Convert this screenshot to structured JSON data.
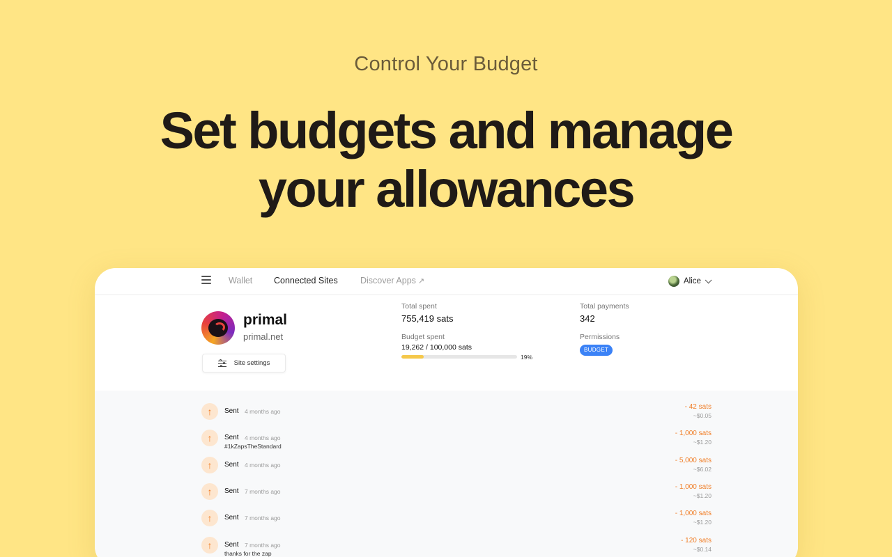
{
  "hero": {
    "eyebrow": "Control Your Budget",
    "headline_line1": "Set budgets and manage",
    "headline_line2": "your allowances"
  },
  "nav": {
    "menu_icon": "hamburger-icon",
    "wallet": "Wallet",
    "connected_sites": "Connected Sites",
    "discover_apps": "Discover Apps",
    "discover_icon": "external-arrow-icon",
    "user_name": "Alice"
  },
  "site": {
    "name": "primal",
    "url": "primal.net",
    "settings_label": "Site settings",
    "settings_icon": "sliders-icon"
  },
  "stats": {
    "total_spent_label": "Total spent",
    "total_spent_value": "755,419 sats",
    "total_payments_label": "Total payments",
    "total_payments_value": "342",
    "budget_spent_label": "Budget spent",
    "budget_spent_value": "19,262 / 100,000 sats",
    "budget_pct_label": "19%",
    "budget_fraction": 0.19,
    "permissions_label": "Permissions",
    "permission_badge": "BUDGET"
  },
  "colors": {
    "background": "#ffe585",
    "accent_orange": "#f07c24",
    "badge_blue": "#3b82f6",
    "progress_yellow": "#f5c84a"
  },
  "transactions": [
    {
      "type": "Sent",
      "time": "4 months ago",
      "memo": "",
      "amount": "- 42 sats",
      "fiat": "~$0.05"
    },
    {
      "type": "Sent",
      "time": "4 months ago",
      "memo": "#1kZapsTheStandard",
      "amount": "- 1,000 sats",
      "fiat": "~$1.20"
    },
    {
      "type": "Sent",
      "time": "4 months ago",
      "memo": "",
      "amount": "- 5,000 sats",
      "fiat": "~$6.02"
    },
    {
      "type": "Sent",
      "time": "7 months ago",
      "memo": "",
      "amount": "- 1,000 sats",
      "fiat": "~$1.20"
    },
    {
      "type": "Sent",
      "time": "7 months ago",
      "memo": "",
      "amount": "- 1,000 sats",
      "fiat": "~$1.20"
    },
    {
      "type": "Sent",
      "time": "7 months ago",
      "memo": "thanks for the zap",
      "amount": "- 120 sats",
      "fiat": "~$0.14"
    }
  ]
}
